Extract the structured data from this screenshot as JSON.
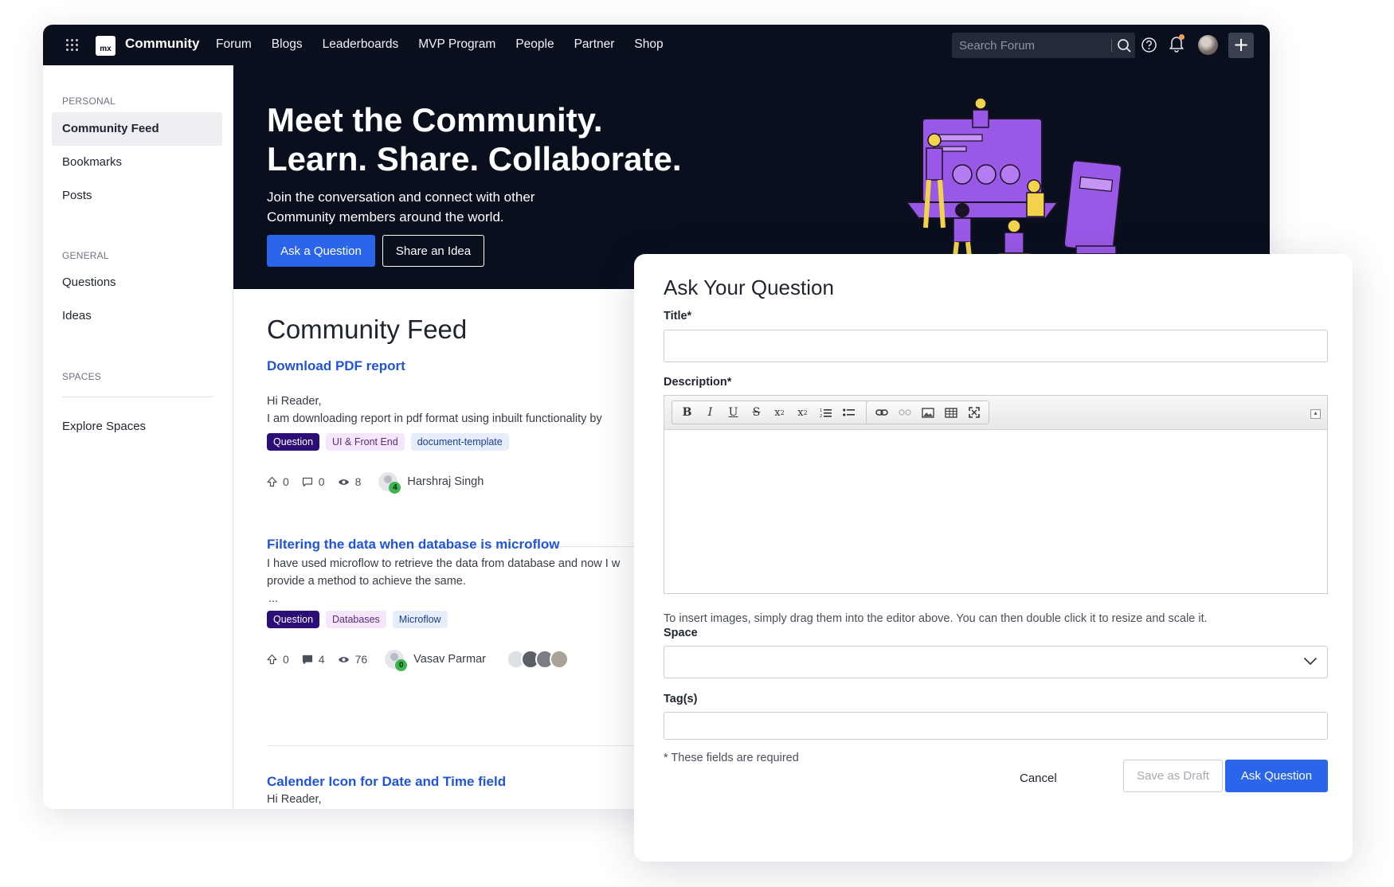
{
  "topbar": {
    "logo_text": "mx",
    "brand": "Community",
    "nav": [
      "Forum",
      "Blogs",
      "Leaderboards",
      "MVP Program",
      "People",
      "Partner",
      "Shop"
    ],
    "search_placeholder": "Search Forum",
    "icons": [
      "apps-grid-icon",
      "search-icon",
      "help-icon",
      "bell-icon",
      "avatar",
      "plus-icon"
    ],
    "plus_label": "+"
  },
  "sidebar": {
    "personal_label": "PERSONAL",
    "personal_items": [
      "Community Feed",
      "Bookmarks",
      "Posts"
    ],
    "general_label": "GENERAL",
    "general_items": [
      "Questions",
      "Ideas"
    ],
    "spaces_label": "SPACES",
    "spaces_items": [
      "Explore Spaces"
    ],
    "active_item": "Community Feed"
  },
  "hero": {
    "title_line1": "Meet the Community.",
    "title_line2": "Learn. Share. Collaborate.",
    "subtitle": "Join the conversation and connect with other Community members around the world.",
    "ask_button": "Ask a Question",
    "share_button": "Share an Idea",
    "illustration_colors": {
      "purple": "#9a58e6",
      "yellow": "#f3d24c"
    }
  },
  "feed": {
    "title": "Community Feed",
    "posts": [
      {
        "title": "Download PDF report",
        "body_line1": "Hi Reader,",
        "body_line2": "I am downloading report in pdf format using inbuilt functionality by",
        "tags": [
          "Question",
          "UI & Front End",
          "document-template"
        ],
        "votes": "0",
        "comments": "0",
        "views": "8",
        "author": "Harshraj Singh",
        "rep": "4"
      },
      {
        "title": "Filtering the data when database is microflow",
        "body_line1": "I have used microflow to retrieve the data from database and now I w",
        "body_line2": "provide a method to achieve the same.",
        "body_line3": "...",
        "tags": [
          "Question",
          "Databases",
          "Microflow"
        ],
        "votes": "0",
        "comments": "4",
        "views": "76",
        "author": "Vasav Parmar",
        "rep": "0"
      },
      {
        "title": "Calender Icon for Date and Time field",
        "body_line1": "Hi Reader,"
      }
    ]
  },
  "dialog": {
    "title": "Ask Your Question",
    "title_label": "Title*",
    "title_value": "",
    "description_label": "Description*",
    "editor_tools": [
      "bold-icon",
      "italic-icon",
      "underline-icon",
      "strikethrough-icon",
      "subscript-icon",
      "superscript-icon",
      "numbered-list-icon",
      "bulleted-list-icon",
      "remove-format-icon",
      "link-icon",
      "unlink-icon",
      "image-icon",
      "table-icon",
      "maximize-icon"
    ],
    "hint": "To insert images, simply drag them into the editor above. You can then double click it to resize and scale it.",
    "space_label": "Space",
    "space_value": "",
    "tags_label": "Tag(s)",
    "tags_value": "",
    "required_note": "* These fields are required",
    "cancel": "Cancel",
    "save_draft": "Save as Draft",
    "ask_question": "Ask Question"
  },
  "colors": {
    "nav_bg": "#0a0f1e",
    "primary": "#2a65ea",
    "link": "#2155d6",
    "question_tag": "#2b0e78"
  }
}
